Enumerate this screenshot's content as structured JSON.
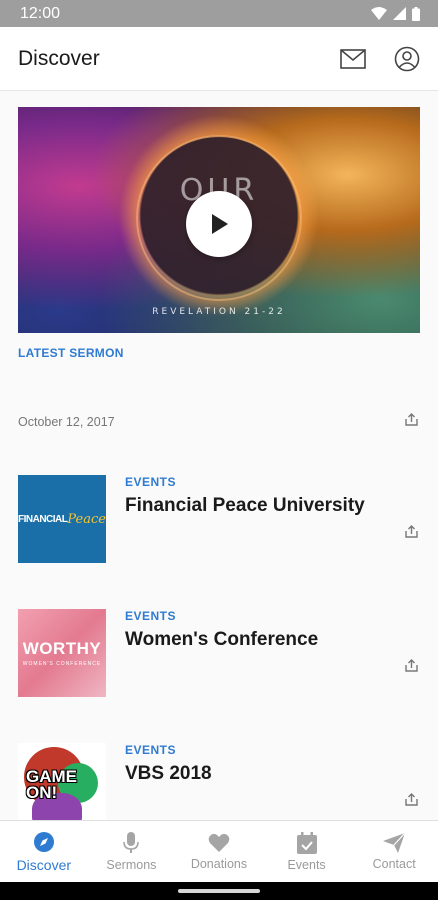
{
  "status_bar": {
    "time": "12:00",
    "icons": [
      "wifi-icon",
      "cell-signal-icon",
      "battery-icon"
    ]
  },
  "app_bar": {
    "title": "Discover",
    "actions": [
      "mail-icon",
      "profile-icon"
    ]
  },
  "hero": {
    "image_text": "OUR",
    "image_caption": "REVELATION 21-22",
    "label": "LATEST SERMON",
    "date": "October 12, 2017"
  },
  "items": [
    {
      "category": "EVENTS",
      "title": "Financial Peace University",
      "thumb_text_a": "FINANCIAL",
      "thumb_text_b": "Peace"
    },
    {
      "category": "EVENTS",
      "title": "Women's Conference",
      "thumb_text_a": "WORTHY",
      "thumb_text_b": "WOMEN'S CONFERENCE"
    },
    {
      "category": "EVENTS",
      "title": "VBS 2018",
      "thumb_text_a": "GAME ON!"
    }
  ],
  "bottom_nav": [
    {
      "label": "Discover",
      "icon": "compass-icon",
      "active": true
    },
    {
      "label": "Sermons",
      "icon": "microphone-icon",
      "active": false
    },
    {
      "label": "Donations",
      "icon": "heart-icon",
      "active": false
    },
    {
      "label": "Events",
      "icon": "calendar-icon",
      "active": false
    },
    {
      "label": "Contact",
      "icon": "send-icon",
      "active": false
    }
  ],
  "colors": {
    "accent": "#2f7bd1",
    "status_bar": "#9e9e9e",
    "inactive": "#9a9a9a"
  }
}
